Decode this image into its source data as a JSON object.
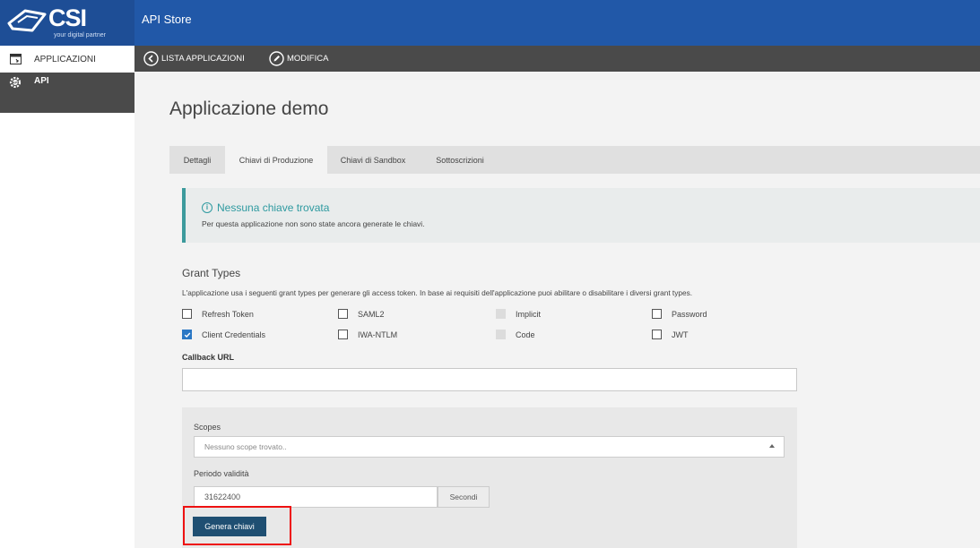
{
  "header": {
    "logo_text": "CSI",
    "logo_tagline": "your digital partner",
    "app_title": "API Store"
  },
  "sidebar": {
    "items": [
      {
        "label": "APPLICAZIONI",
        "icon": "window-icon"
      },
      {
        "label": "API",
        "icon": "api-gear-icon"
      }
    ]
  },
  "toolbar": {
    "back_label": "LISTA APPLICAZIONI",
    "edit_label": "MODIFICA"
  },
  "page": {
    "title": "Applicazione demo"
  },
  "tabs": [
    {
      "label": "Dettagli",
      "active": false
    },
    {
      "label": "Chiavi di Produzione",
      "active": true
    },
    {
      "label": "Chiavi di Sandbox",
      "active": false
    },
    {
      "label": "Sottoscrizioni",
      "active": false
    }
  ],
  "alert": {
    "title": "Nessuna chiave trovata",
    "text": "Per questa applicazione non sono state ancora generate le chiavi."
  },
  "grant_types": {
    "heading": "Grant Types",
    "description": "L'applicazione usa i seguenti grant types per generare gli access token. In base ai requisiti dell'applicazione puoi abilitare o disabilitare i diversi grant types.",
    "options": [
      {
        "label": "Refresh Token",
        "checked": false,
        "disabled": false
      },
      {
        "label": "SAML2",
        "checked": false,
        "disabled": false
      },
      {
        "label": "Implicit",
        "checked": false,
        "disabled": true
      },
      {
        "label": "Password",
        "checked": false,
        "disabled": false
      },
      {
        "label": "Client Credentials",
        "checked": true,
        "disabled": false
      },
      {
        "label": "IWA-NTLM",
        "checked": false,
        "disabled": false
      },
      {
        "label": "Code",
        "checked": false,
        "disabled": true
      },
      {
        "label": "JWT",
        "checked": false,
        "disabled": false
      }
    ]
  },
  "callback": {
    "label": "Callback URL",
    "value": ""
  },
  "scopes": {
    "label": "Scopes",
    "placeholder": "Nessuno scope trovato.."
  },
  "period": {
    "label": "Periodo validità",
    "value": "31622400",
    "unit": "Secondi"
  },
  "generate_button": "Genera chiavi",
  "colors": {
    "header": "#2158a8",
    "toolbar": "#4a4a4a",
    "alert_accent": "#3c9a9c",
    "primary_button": "#1f4f72",
    "highlight": "#e11111",
    "checkbox_checked": "#2b78c5"
  }
}
